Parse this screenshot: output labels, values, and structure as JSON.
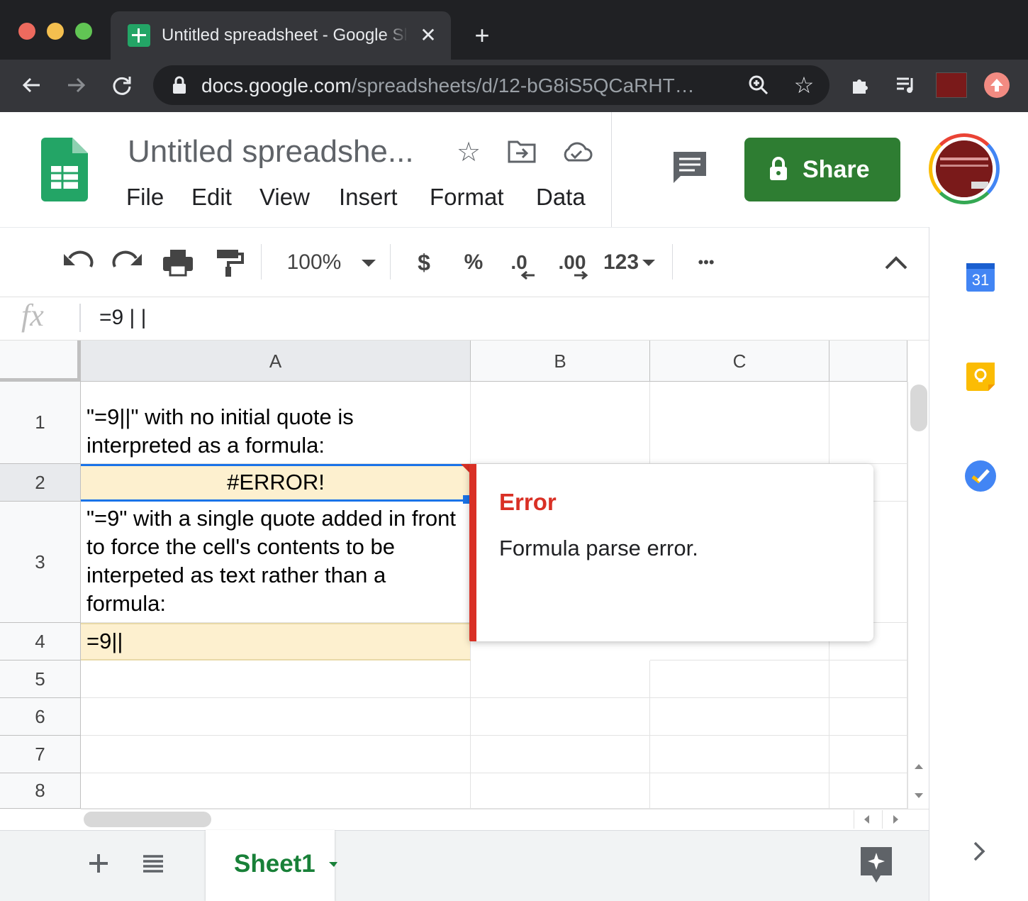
{
  "browser": {
    "tab_title": "Untitled spreadsheet - Google Sheets",
    "tab_close": "✕",
    "new_tab": "+",
    "url_host": "docs.google.com",
    "url_path": "/spreadsheets/d/12-bG8iS5QCaRHT…"
  },
  "doc": {
    "title": "Untitled spreadshe...",
    "menu": [
      "File",
      "Edit",
      "View",
      "Insert",
      "Format",
      "Data"
    ],
    "share_label": "Share"
  },
  "toolbar": {
    "zoom": "100%",
    "currency": "$",
    "percent": "%",
    "dec_decrease": ".0",
    "dec_increase": ".00",
    "number_format": "123",
    "more": "•••"
  },
  "formula_bar": {
    "fx": "fx",
    "value": "=9 | |"
  },
  "grid": {
    "columns": [
      "A",
      "B",
      "C"
    ],
    "rows": [
      "1",
      "2",
      "3",
      "4",
      "5",
      "6",
      "7",
      "8"
    ],
    "cells": {
      "A1": "\"=9||\" with no initial quote is interpreted as a formula:",
      "A2": "#ERROR!",
      "A3": "\"=9\" with a single quote added in front to force the cell's contents to be interpeted as text rather than a formula:",
      "A4": "=9||"
    },
    "highlight_color": "#fdf0cf"
  },
  "error_popup": {
    "title": "Error",
    "message": "Formula parse error."
  },
  "sheets": {
    "active": "Sheet1"
  },
  "side_panel": {
    "calendar_day": "31"
  },
  "colors": {
    "share_green": "#2e7d32",
    "error_red": "#d93025",
    "sheet_tab_green": "#188038"
  }
}
